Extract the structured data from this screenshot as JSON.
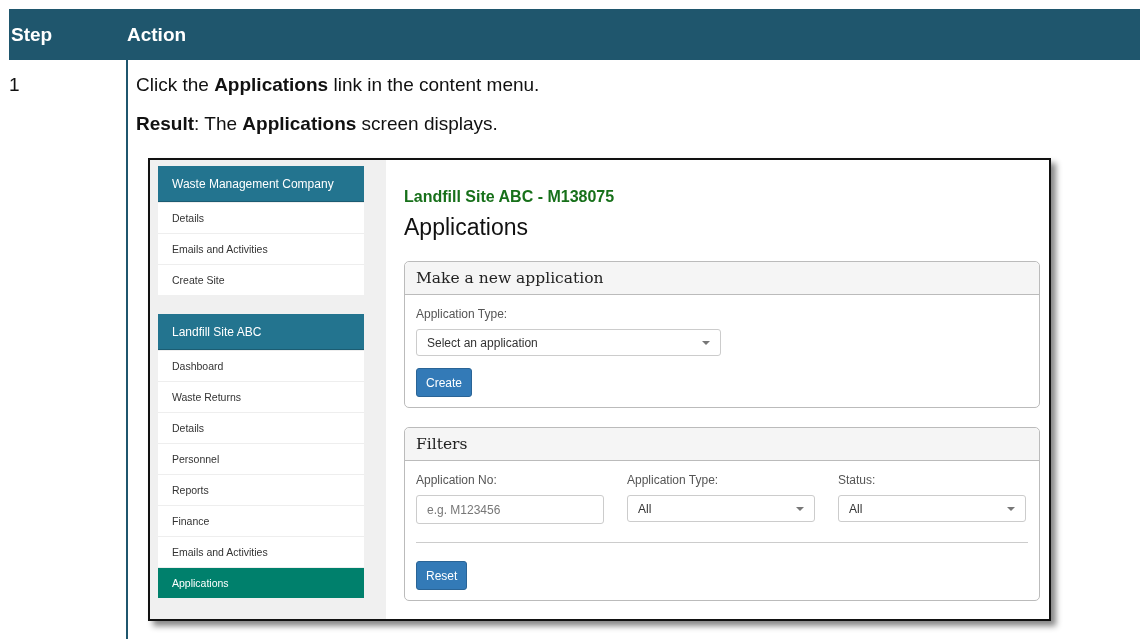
{
  "table": {
    "columns": [
      "Step",
      "Action"
    ],
    "rows": [
      {
        "step": "1",
        "instruction": "Click the **Applications** link in the content menu.",
        "result": "**Result**: The **Applications** screen displays.",
        "screenshot": {
          "sidebar": {
            "groups": [
              {
                "title": "Waste Management Company",
                "items": [
                  {
                    "label": "Details",
                    "selected": false
                  },
                  {
                    "label": "Emails and Activities",
                    "selected": false
                  },
                  {
                    "label": "Create Site",
                    "selected": false
                  }
                ]
              },
              {
                "title": "Landfill Site ABC",
                "items": [
                  {
                    "label": "Dashboard",
                    "selected": false
                  },
                  {
                    "label": "Waste Returns",
                    "selected": false
                  },
                  {
                    "label": "Details",
                    "selected": false
                  },
                  {
                    "label": "Personnel",
                    "selected": false
                  },
                  {
                    "label": "Reports",
                    "selected": false
                  },
                  {
                    "label": "Finance",
                    "selected": false
                  },
                  {
                    "label": "Emails and Activities",
                    "selected": false
                  },
                  {
                    "label": "Applications",
                    "selected": true
                  }
                ]
              }
            ]
          },
          "site_title": "Landfill Site ABC - M138075",
          "page_title": "Applications",
          "new_application": {
            "title": "Make a new application",
            "field_label": "Application Type:",
            "select_value": "Select an application",
            "button": "Create"
          },
          "filters": {
            "title": "Filters",
            "fields": [
              {
                "kind": "text",
                "label": "Application No:",
                "placeholder": "e.g. M123456"
              },
              {
                "kind": "select",
                "label": "Application Type:",
                "value": "All"
              },
              {
                "kind": "select",
                "label": "Status:",
                "value": "All"
              }
            ],
            "button": "Reset"
          }
        }
      }
    ]
  }
}
